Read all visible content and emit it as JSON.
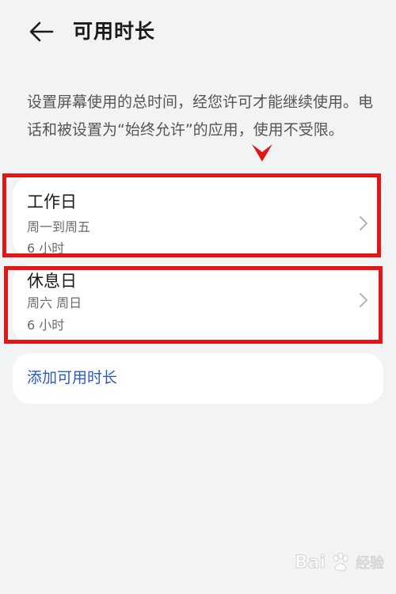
{
  "header": {
    "back_icon": "arrow-left-icon",
    "title": "可用时长"
  },
  "description": "设置屏幕使用的总时间，经您许可才能继续使用。电话和被设置为“始终允许”的应用，使用不受限。",
  "schedules": [
    {
      "title": "工作日",
      "days": "周一到周五",
      "hours": "6 小时"
    },
    {
      "title": "休息日",
      "days": "周六 周日",
      "hours": "6 小时"
    }
  ],
  "add_button": {
    "label": "添加可用时长"
  },
  "watermark": {
    "brand": "Bai",
    "suffix": "经验"
  },
  "colors": {
    "background": "#f1f3f5",
    "card": "#ffffff",
    "accent": "#2a5bbd",
    "annotation": "#e31515"
  }
}
